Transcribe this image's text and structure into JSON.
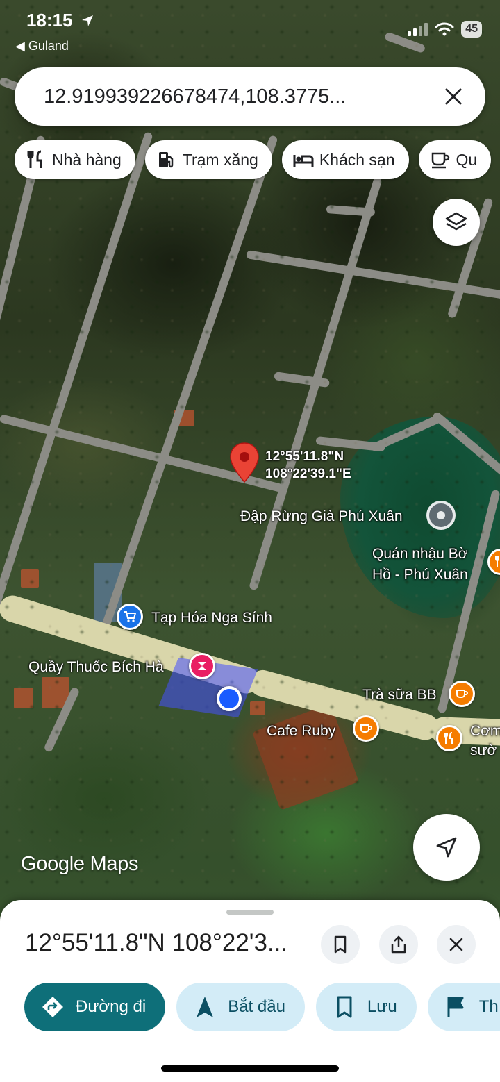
{
  "status_bar": {
    "time": "18:15",
    "back_app": "◀ Guland",
    "battery": "45"
  },
  "search": {
    "value": "12.91993922667847­4,108.3775...",
    "close_icon": "close-icon"
  },
  "chips": [
    {
      "label": "Nhà hàng",
      "icon": "restaurant-icon"
    },
    {
      "label": "Trạm xăng",
      "icon": "gas-station-icon"
    },
    {
      "label": "Khách sạn",
      "icon": "hotel-icon"
    },
    {
      "label": "Qu",
      "icon": "coffee-icon"
    }
  ],
  "map": {
    "dropped_pin": {
      "lat": "12°55'11.8\"N",
      "lng": "108°22'39.1\"E"
    },
    "places": {
      "dam": "Đập Rừng Già Phú Xuân",
      "quan_nhau_1": "Quán nhậu Bờ",
      "quan_nhau_2": "Hồ - Phú Xuân",
      "grocery": "Tạp Hóa Nga Sính",
      "pharmacy": "Quầy Thuốc Bích Hà",
      "milk_tea": "Trà sữa BB",
      "cafe": "Cafe Ruby",
      "com_1": "Cơm",
      "com_2": "sườ"
    },
    "logo": "Google Maps",
    "colors": {
      "restaurant": "#f57c00",
      "shop": "#1a73e8",
      "pharmacy": "#e91e63",
      "my_location": "#1a5cff"
    }
  },
  "sheet": {
    "title": "12°55'11.8\"N 108°22'3...",
    "actions": [
      {
        "label": "Đường đi",
        "icon": "directions-icon"
      },
      {
        "label": "Bắt đầu",
        "icon": "navigation-arrow-icon"
      },
      {
        "label": "Lưu",
        "icon": "bookmark-icon"
      },
      {
        "label": "Th",
        "icon": "flag-icon"
      }
    ]
  }
}
